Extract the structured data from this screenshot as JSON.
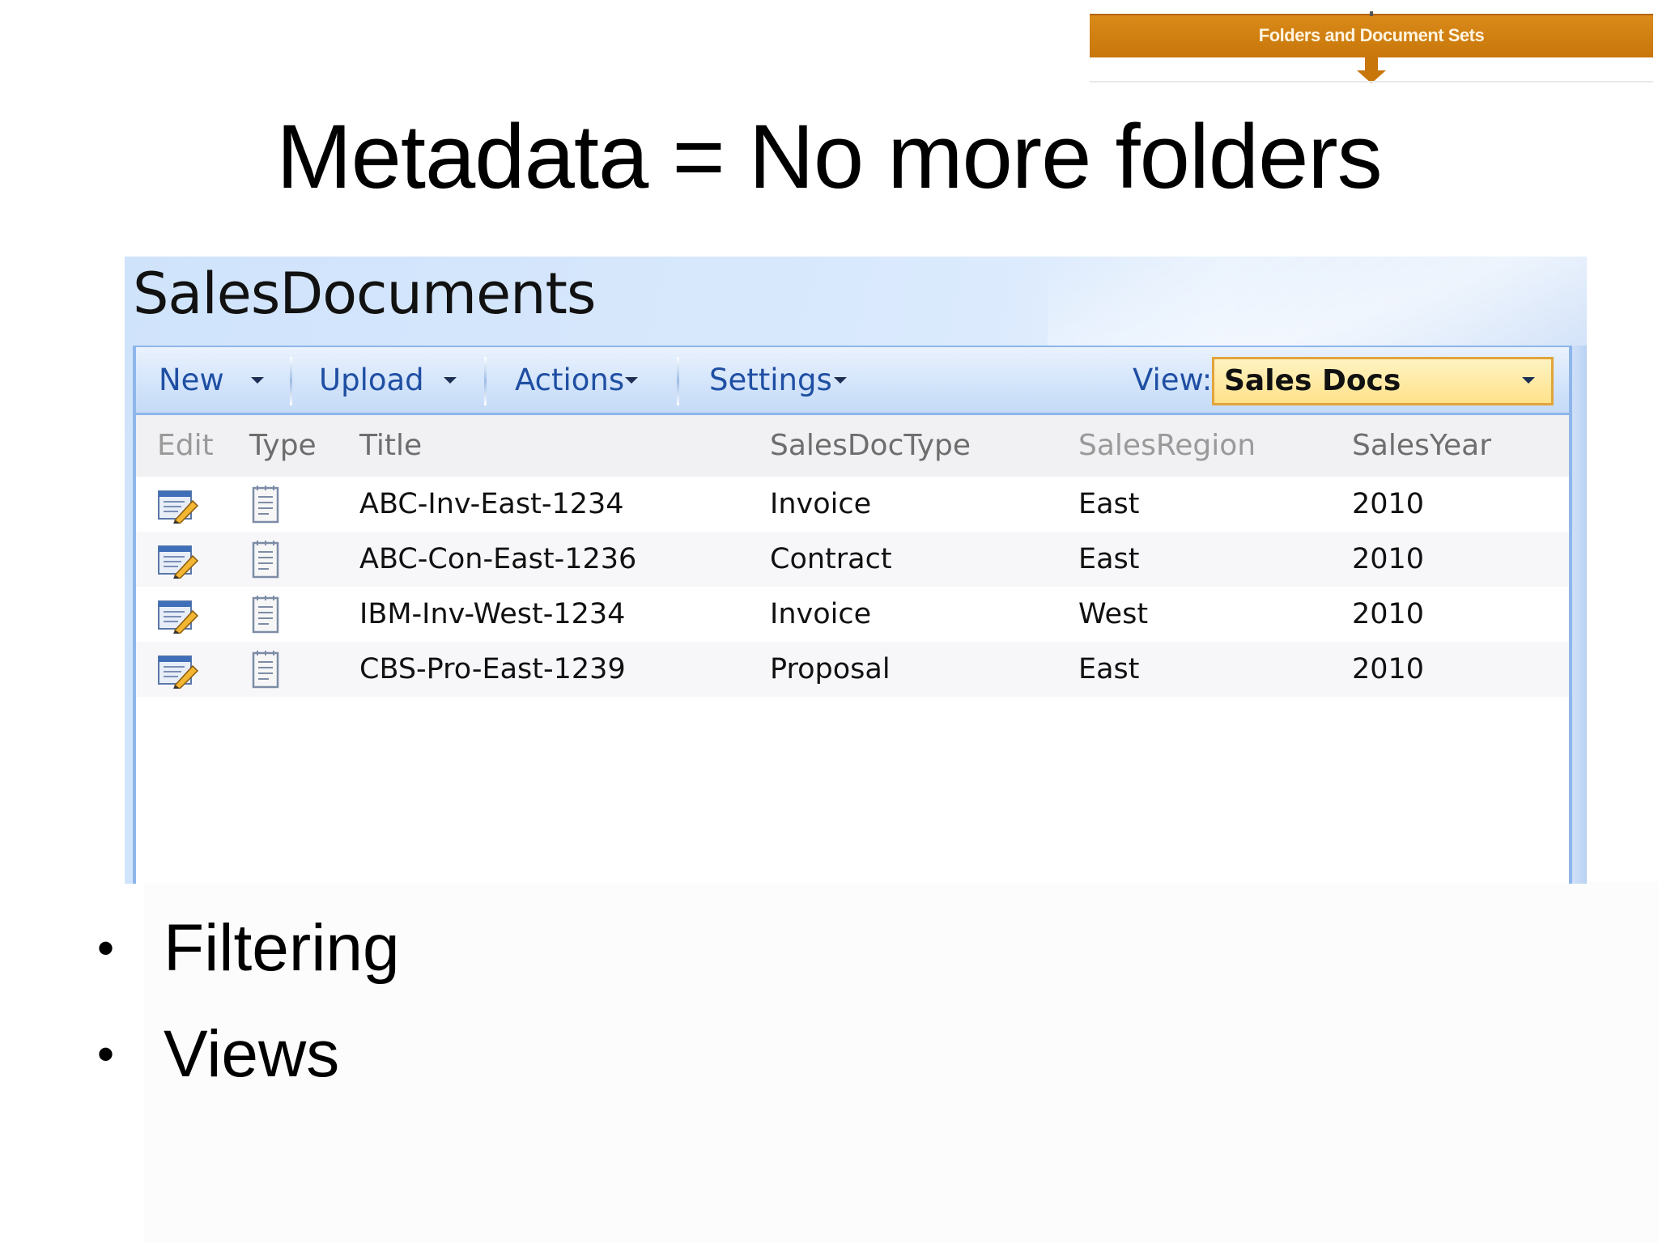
{
  "banner": {
    "label": "Folders and Document Sets",
    "color": "#c8760a"
  },
  "slide": {
    "title": "Metadata = No more folders"
  },
  "library": {
    "title": "SalesDocuments",
    "toolbar": {
      "new_label": "New",
      "upload_label": "Upload",
      "actions_label": "Actions",
      "settings_label": "Settings",
      "view_label": "View:",
      "view_value": "Sales Docs"
    },
    "columns": [
      "Edit",
      "Type",
      "Title",
      "SalesDocType",
      "SalesRegion",
      "SalesYear"
    ],
    "rows": [
      {
        "title": "ABC-Inv-East-1234",
        "doctype": "Invoice",
        "region": "East",
        "year": "2010"
      },
      {
        "title": "ABC-Con-East-1236",
        "doctype": "Contract",
        "region": "East",
        "year": "2010"
      },
      {
        "title": "IBM-Inv-West-1234",
        "doctype": "Invoice",
        "region": "West",
        "year": "2010"
      },
      {
        "title": "CBS-Pro-East-1239",
        "doctype": "Proposal",
        "region": "East",
        "year": "2010"
      }
    ],
    "icons": {
      "edit": "edit-document-icon",
      "type": "document-icon"
    },
    "colors": {
      "link": "#1f4fa3",
      "panel": "#cfe3fb",
      "view_select": "#ffe28a"
    }
  },
  "bullets": [
    "Filtering",
    "Views"
  ]
}
